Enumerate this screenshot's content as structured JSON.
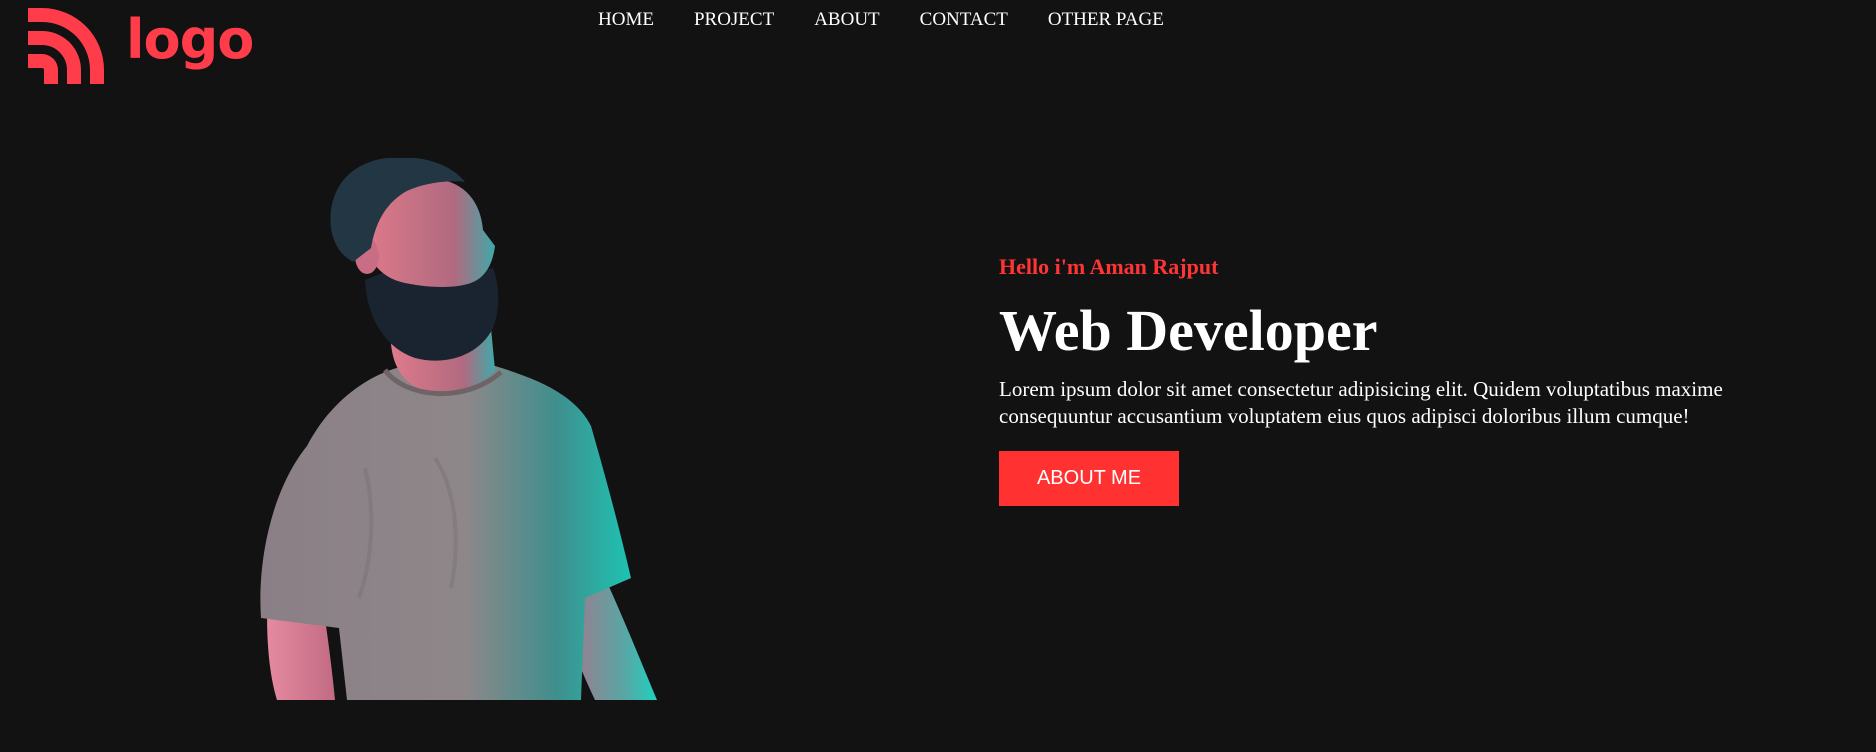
{
  "header": {
    "logo_text": "logo",
    "nav": [
      {
        "label": "HOME"
      },
      {
        "label": "PROJECT"
      },
      {
        "label": "ABOUT"
      },
      {
        "label": "CONTACT"
      },
      {
        "label": "OTHER PAGE"
      }
    ]
  },
  "hero": {
    "greeting": "Hello i'm Aman Rajput",
    "role": "Web Developer",
    "bio": "Lorem ipsum dolor sit amet consectetur adipisicing elit. Quidem voluptatibus maxime consequuntur accusantium voluptatem eius quos adipisci doloribus illum cumque!",
    "cta_label": "ABOUT ME",
    "image_icon": "person-portrait-icon"
  },
  "colors": {
    "background": "#121212",
    "accent": "#ff3535",
    "text": "#ffffff",
    "logo": "#ff3c4a"
  }
}
